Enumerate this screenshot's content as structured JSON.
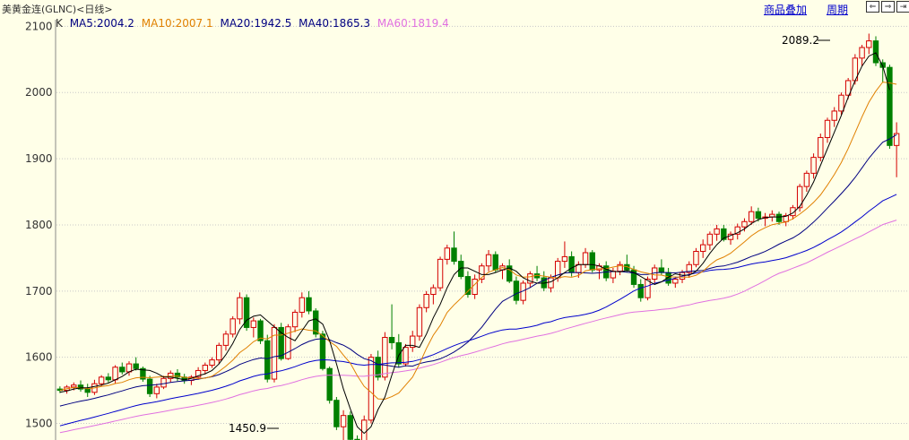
{
  "header": {
    "title": "美黄金连(GLNC)<日线>",
    "overlay_link": "商品叠加",
    "period_link": "周期",
    "nav_left": "⇐",
    "nav_right": "⇒",
    "nav_end": "⇥"
  },
  "legend": {
    "k_label": "K",
    "ma5": "MA5:2004.2",
    "ma10": "MA10:2007.1",
    "ma20": "MA20:1942.5",
    "ma40": "MA40:1865.3",
    "ma60": "MA60:1819.4"
  },
  "colors": {
    "background": "#FFFFE8",
    "grid": "#C8C8C8",
    "up": "#D40000",
    "down": "#008000",
    "ma5": "#000000",
    "ma10": "#E08000",
    "ma20": "#000080",
    "ma40": "#0000CC",
    "ma60": "#E070E0"
  },
  "chart_data": {
    "type": "candlestick",
    "ylim": [
      1475,
      2110
    ],
    "yticks": [
      "1500",
      "1600",
      "1700",
      "1800",
      "1900",
      "2000",
      "2100"
    ],
    "annotations": {
      "high": "2089.2",
      "low": "1450.9"
    },
    "candles": [
      [
        1552,
        1556,
        1546,
        1550
      ],
      [
        1550,
        1558,
        1545,
        1555
      ],
      [
        1555,
        1562,
        1550,
        1558
      ],
      [
        1558,
        1565,
        1548,
        1552
      ],
      [
        1552,
        1560,
        1540,
        1547
      ],
      [
        1547,
        1566,
        1543,
        1560
      ],
      [
        1560,
        1573,
        1556,
        1570
      ],
      [
        1570,
        1576,
        1562,
        1566
      ],
      [
        1566,
        1588,
        1560,
        1585
      ],
      [
        1585,
        1592,
        1574,
        1578
      ],
      [
        1578,
        1594,
        1572,
        1590
      ],
      [
        1590,
        1600,
        1580,
        1583
      ],
      [
        1583,
        1586,
        1563,
        1567
      ],
      [
        1567,
        1572,
        1540,
        1545
      ],
      [
        1545,
        1560,
        1538,
        1555
      ],
      [
        1555,
        1572,
        1552,
        1568
      ],
      [
        1568,
        1580,
        1562,
        1576
      ],
      [
        1576,
        1582,
        1564,
        1570
      ],
      [
        1570,
        1575,
        1560,
        1565
      ],
      [
        1565,
        1573,
        1558,
        1570
      ],
      [
        1570,
        1585,
        1566,
        1580
      ],
      [
        1580,
        1592,
        1574,
        1588
      ],
      [
        1588,
        1600,
        1584,
        1596
      ],
      [
        1596,
        1622,
        1590,
        1618
      ],
      [
        1618,
        1640,
        1610,
        1635
      ],
      [
        1635,
        1662,
        1630,
        1658
      ],
      [
        1658,
        1698,
        1650,
        1690
      ],
      [
        1690,
        1695,
        1640,
        1645
      ],
      [
        1645,
        1660,
        1630,
        1655
      ],
      [
        1655,
        1658,
        1620,
        1625
      ],
      [
        1625,
        1634,
        1562,
        1567
      ],
      [
        1567,
        1650,
        1562,
        1645
      ],
      [
        1645,
        1652,
        1595,
        1598
      ],
      [
        1598,
        1650,
        1596,
        1646
      ],
      [
        1646,
        1672,
        1638,
        1668
      ],
      [
        1668,
        1698,
        1660,
        1690
      ],
      [
        1690,
        1700,
        1665,
        1670
      ],
      [
        1670,
        1674,
        1630,
        1635
      ],
      [
        1635,
        1640,
        1580,
        1583
      ],
      [
        1583,
        1586,
        1530,
        1535
      ],
      [
        1535,
        1540,
        1490,
        1495
      ],
      [
        1495,
        1520,
        1465,
        1512
      ],
      [
        1512,
        1518,
        1470,
        1476
      ],
      [
        1476,
        1482,
        1455,
        1460
      ],
      [
        1460,
        1512,
        1451,
        1505
      ],
      [
        1505,
        1605,
        1500,
        1600
      ],
      [
        1600,
        1610,
        1565,
        1570
      ],
      [
        1570,
        1638,
        1565,
        1630
      ],
      [
        1630,
        1680,
        1612,
        1622
      ],
      [
        1622,
        1635,
        1585,
        1590
      ],
      [
        1590,
        1620,
        1586,
        1615
      ],
      [
        1615,
        1640,
        1608,
        1632
      ],
      [
        1632,
        1680,
        1625,
        1675
      ],
      [
        1675,
        1700,
        1668,
        1695
      ],
      [
        1695,
        1710,
        1680,
        1705
      ],
      [
        1705,
        1752,
        1700,
        1748
      ],
      [
        1748,
        1770,
        1740,
        1765
      ],
      [
        1765,
        1790,
        1740,
        1745
      ],
      [
        1745,
        1755,
        1718,
        1722
      ],
      [
        1722,
        1730,
        1690,
        1695
      ],
      [
        1695,
        1725,
        1688,
        1718
      ],
      [
        1718,
        1742,
        1712,
        1738
      ],
      [
        1738,
        1762,
        1730,
        1755
      ],
      [
        1755,
        1760,
        1728,
        1732
      ],
      [
        1732,
        1742,
        1718,
        1738
      ],
      [
        1738,
        1748,
        1712,
        1715
      ],
      [
        1715,
        1722,
        1680,
        1686
      ],
      [
        1686,
        1716,
        1680,
        1712
      ],
      [
        1712,
        1730,
        1705,
        1726
      ],
      [
        1726,
        1738,
        1715,
        1720
      ],
      [
        1720,
        1730,
        1700,
        1705
      ],
      [
        1705,
        1725,
        1698,
        1720
      ],
      [
        1720,
        1750,
        1714,
        1745
      ],
      [
        1745,
        1775,
        1735,
        1752
      ],
      [
        1752,
        1760,
        1722,
        1728
      ],
      [
        1728,
        1745,
        1720,
        1740
      ],
      [
        1740,
        1765,
        1735,
        1758
      ],
      [
        1758,
        1762,
        1728,
        1732
      ],
      [
        1732,
        1742,
        1718,
        1738
      ],
      [
        1738,
        1745,
        1715,
        1720
      ],
      [
        1720,
        1735,
        1712,
        1730
      ],
      [
        1730,
        1745,
        1724,
        1740
      ],
      [
        1740,
        1755,
        1728,
        1732
      ],
      [
        1732,
        1738,
        1705,
        1710
      ],
      [
        1710,
        1718,
        1684,
        1690
      ],
      [
        1690,
        1722,
        1686,
        1718
      ],
      [
        1718,
        1740,
        1712,
        1735
      ],
      [
        1735,
        1748,
        1724,
        1728
      ],
      [
        1728,
        1735,
        1708,
        1712
      ],
      [
        1712,
        1722,
        1705,
        1718
      ],
      [
        1718,
        1732,
        1712,
        1728
      ],
      [
        1728,
        1745,
        1720,
        1740
      ],
      [
        1740,
        1765,
        1736,
        1760
      ],
      [
        1760,
        1778,
        1750,
        1770
      ],
      [
        1770,
        1790,
        1762,
        1786
      ],
      [
        1786,
        1800,
        1776,
        1794
      ],
      [
        1794,
        1800,
        1775,
        1778
      ],
      [
        1778,
        1790,
        1770,
        1786
      ],
      [
        1786,
        1802,
        1778,
        1797
      ],
      [
        1797,
        1810,
        1790,
        1805
      ],
      [
        1805,
        1828,
        1800,
        1820
      ],
      [
        1820,
        1826,
        1805,
        1810
      ],
      [
        1810,
        1818,
        1798,
        1812
      ],
      [
        1812,
        1822,
        1805,
        1816
      ],
      [
        1816,
        1820,
        1800,
        1805
      ],
      [
        1805,
        1818,
        1798,
        1814
      ],
      [
        1814,
        1830,
        1808,
        1826
      ],
      [
        1826,
        1862,
        1820,
        1858
      ],
      [
        1858,
        1882,
        1850,
        1878
      ],
      [
        1878,
        1908,
        1870,
        1902
      ],
      [
        1902,
        1938,
        1896,
        1932
      ],
      [
        1932,
        1962,
        1924,
        1958
      ],
      [
        1958,
        1978,
        1948,
        1972
      ],
      [
        1972,
        2000,
        1966,
        1996
      ],
      [
        1996,
        2022,
        1990,
        2018
      ],
      [
        2018,
        2058,
        2012,
        2052
      ],
      [
        2052,
        2072,
        2040,
        2068
      ],
      [
        2068,
        2089,
        2058,
        2078
      ],
      [
        2078,
        2085,
        2040,
        2045
      ],
      [
        2045,
        2050,
        2015,
        2038
      ],
      [
        2038,
        2042,
        1915,
        1920
      ],
      [
        1920,
        1955,
        1872,
        1938
      ]
    ],
    "ma": {
      "ma5": [
        1547,
        1549,
        1552,
        1554,
        1554,
        1556,
        1558,
        1561,
        1566,
        1571,
        1578,
        1582,
        1581,
        1580,
        1576,
        1570,
        1570,
        1568,
        1566,
        1568,
        1572,
        1575,
        1580,
        1590,
        1604,
        1621,
        1642,
        1656,
        1662,
        1664,
        1655,
        1646,
        1637,
        1630,
        1625,
        1640,
        1655,
        1658,
        1650,
        1625,
        1590,
        1552,
        1522,
        1495,
        1485,
        1495,
        1521,
        1540,
        1573,
        1603,
        1618,
        1618,
        1615,
        1635,
        1660,
        1680,
        1705,
        1725,
        1735,
        1735,
        1730,
        1725,
        1725,
        1728,
        1732,
        1735,
        1730,
        1720,
        1715,
        1712,
        1712,
        1714,
        1720,
        1728,
        1735,
        1740,
        1740,
        1740,
        1738,
        1733,
        1730,
        1729,
        1731,
        1728,
        1722,
        1716,
        1710,
        1714,
        1721,
        1726,
        1724,
        1724,
        1730,
        1742,
        1757,
        1770,
        1780,
        1784,
        1788,
        1794,
        1802,
        1808,
        1811,
        1812,
        1812,
        1813,
        1818,
        1828,
        1845,
        1865,
        1890,
        1915,
        1940,
        1965,
        1993,
        2018,
        2040,
        2055,
        2060,
        2040,
        2004
      ]
    }
  }
}
